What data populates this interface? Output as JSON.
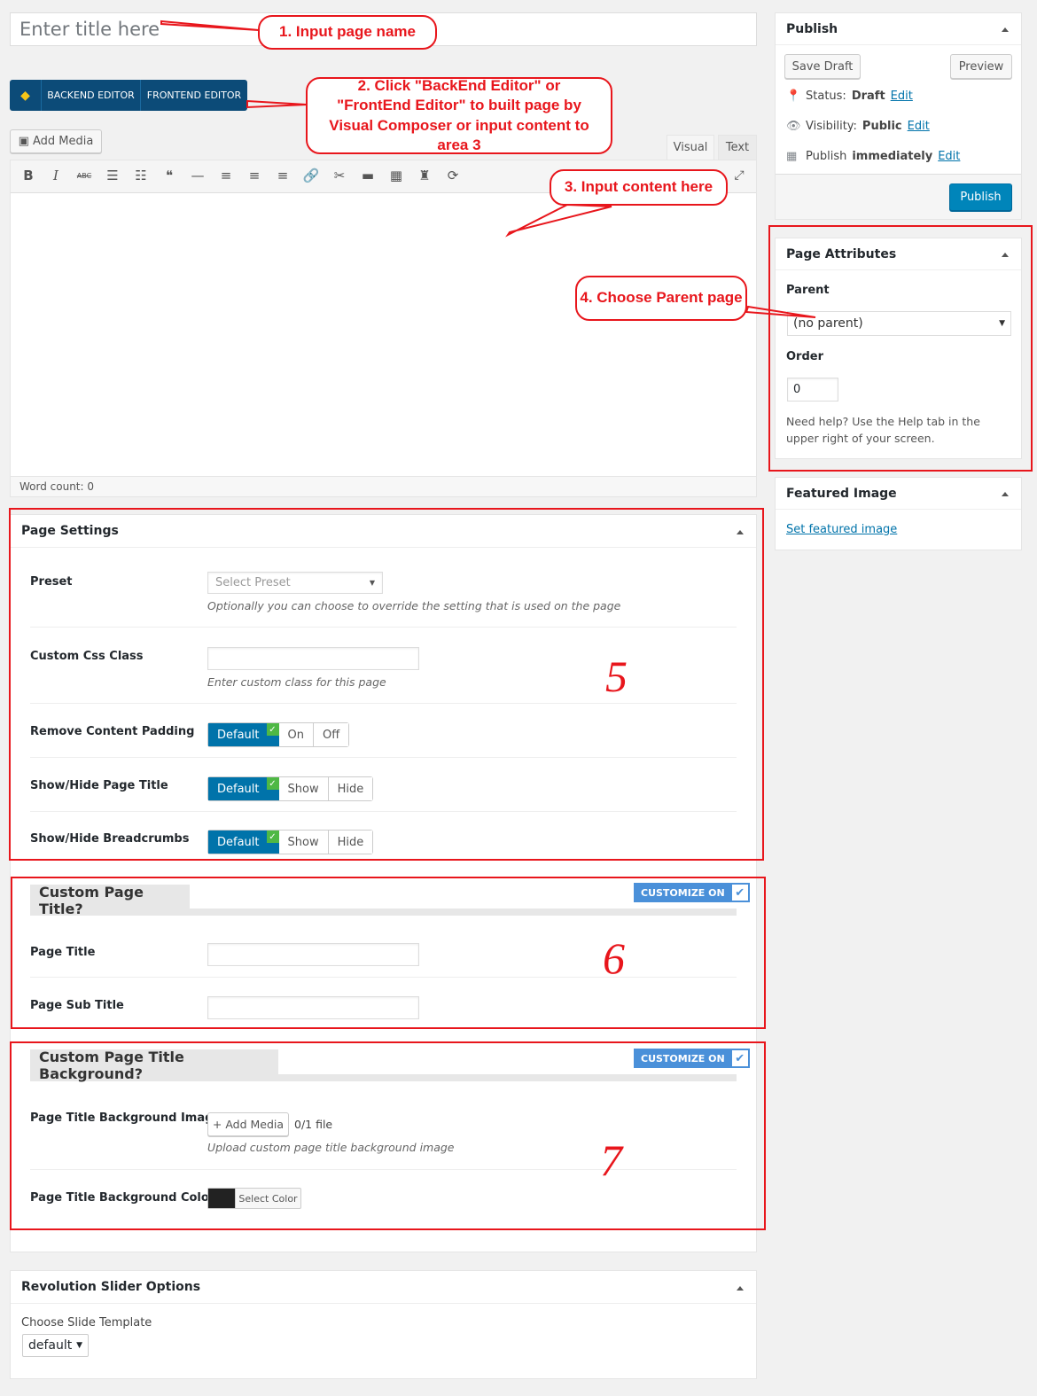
{
  "title_input": {
    "placeholder": "Enter title here"
  },
  "vc": {
    "backend_label": "BACKEND EDITOR",
    "frontend_label": "FRONTEND EDITOR"
  },
  "editor": {
    "add_media_label": "Add Media",
    "tab_visual": "Visual",
    "tab_text": "Text",
    "word_count": "Word count: 0",
    "tools": [
      "bold-icon",
      "italic-icon",
      "strikethrough-icon",
      "bullet-list-icon",
      "numbered-list-icon",
      "blockquote-icon",
      "horizontal-rule-icon",
      "align-left-icon",
      "align-center-icon",
      "align-right-icon",
      "link-icon",
      "unlink-icon",
      "read-more-icon",
      "toolbar-toggle-icon",
      "vc-shortcode-icon",
      "refresh-icon"
    ],
    "tool_glyphs": [
      "B",
      "I",
      "ABC",
      "☰",
      "☷",
      "❝",
      "—",
      "≡",
      "≡",
      "≡",
      "🔗",
      "✂",
      "▬",
      "▦",
      "♜",
      "⟳"
    ]
  },
  "callouts": {
    "c1": "1. Input page name",
    "c2": "2. Click \"BackEnd Editor\" or \"FrontEnd Editor\" to built page by Visual Composer or input content to area 3",
    "c3": "3. Input content here",
    "c4": "4. Choose Parent page",
    "n5": "5",
    "n6": "6",
    "n7": "7"
  },
  "publish": {
    "title": "Publish",
    "save_draft": "Save Draft",
    "preview": "Preview",
    "status_label": "Status:",
    "status_value": "Draft",
    "visibility_label": "Visibility:",
    "visibility_value": "Public",
    "publish_label": "Publish",
    "publish_value": "immediately",
    "edit": "Edit",
    "publish_button": "Publish"
  },
  "page_attributes": {
    "title": "Page Attributes",
    "parent_label": "Parent",
    "parent_value": "(no parent)",
    "order_label": "Order",
    "order_value": "0",
    "help": "Need help? Use the Help tab in the upper right of your screen."
  },
  "featured_image": {
    "title": "Featured Image",
    "link": "Set featured image"
  },
  "page_settings": {
    "title": "Page Settings",
    "preset_label": "Preset",
    "preset_placeholder": "Select Preset",
    "preset_desc": "Optionally you can choose to override the setting that is used on the page",
    "css_label": "Custom Css Class",
    "css_desc": "Enter custom class for this page",
    "padding_label": "Remove Content Padding",
    "title_toggle_label": "Show/Hide Page Title",
    "breadcrumbs_label": "Show/Hide Breadcrumbs",
    "opt_default": "Default",
    "opt_on": "On",
    "opt_off": "Off",
    "opt_show": "Show",
    "opt_hide": "Hide"
  },
  "custom_title": {
    "title": "Custom Page Title?",
    "customize": "CUSTOMIZE ON",
    "page_title_label": "Page Title",
    "page_sub_title_label": "Page Sub Title"
  },
  "custom_bg": {
    "title": "Custom Page Title Background?",
    "customize": "CUSTOMIZE ON",
    "image_label": "Page Title Background Image",
    "add_media": "+ Add Media",
    "file_count": "0/1 file",
    "image_desc": "Upload custom page title background image",
    "color_label": "Page Title Background Color",
    "select_color": "Select Color",
    "color_swatch": "#222222"
  },
  "revolution": {
    "title": "Revolution Slider Options",
    "template_label": "Choose Slide Template",
    "template_value": "default"
  }
}
